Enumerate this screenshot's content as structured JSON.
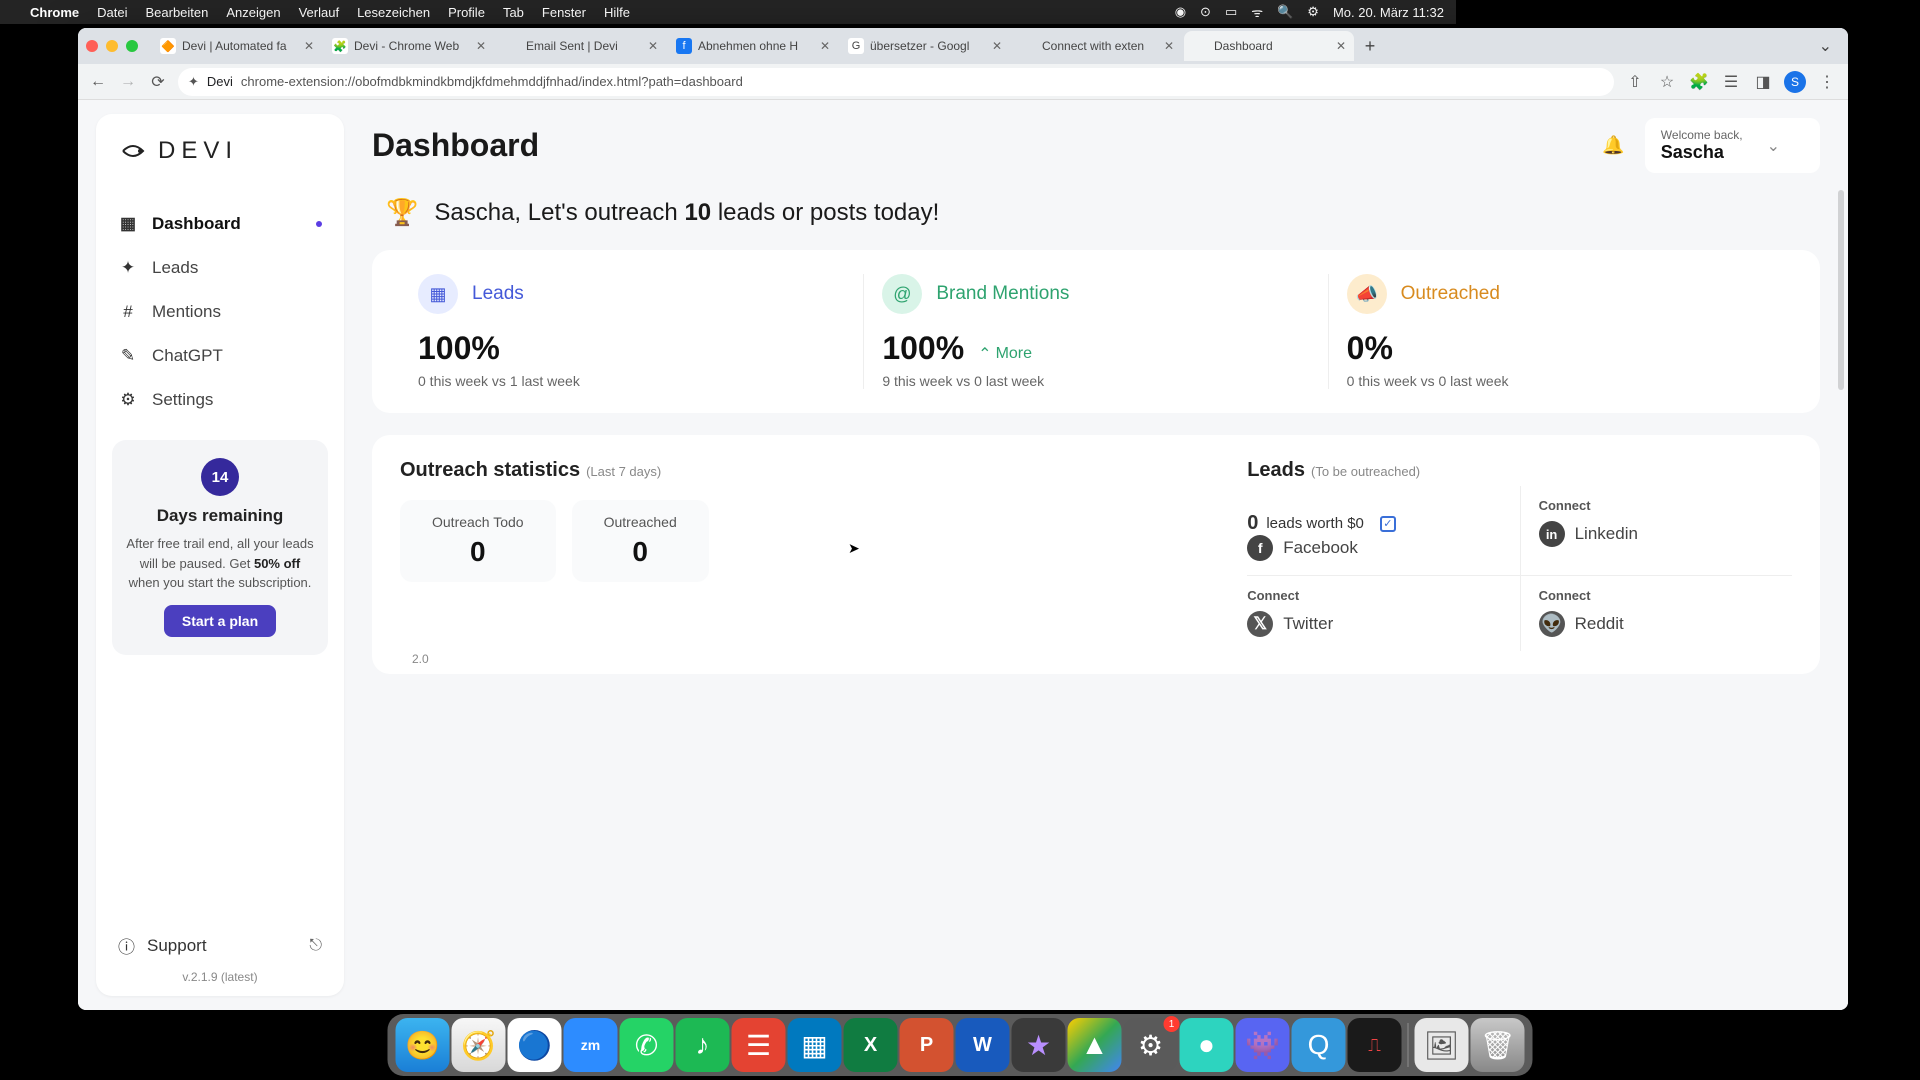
{
  "menubar": {
    "app": "Chrome",
    "items": [
      "Datei",
      "Bearbeiten",
      "Anzeigen",
      "Verlauf",
      "Lesezeichen",
      "Profile",
      "Tab",
      "Fenster",
      "Hilfe"
    ],
    "clock": "Mo. 20. März  11:32"
  },
  "tabs": [
    {
      "label": "Devi | Automated fa"
    },
    {
      "label": "Devi - Chrome Web"
    },
    {
      "label": "Email Sent | Devi"
    },
    {
      "label": "Abnehmen ohne H"
    },
    {
      "label": "übersetzer - Googl"
    },
    {
      "label": "Connect with exten"
    },
    {
      "label": "Dashboard",
      "active": true
    }
  ],
  "addressbar": {
    "host": "Devi",
    "path": "chrome-extension://obofmdbkmindkbmdjkfdmehmddjfnhad/index.html?path=dashboard"
  },
  "sidebar": {
    "logo": "DEVI",
    "nav": [
      {
        "label": "Dashboard",
        "active": true
      },
      {
        "label": "Leads"
      },
      {
        "label": "Mentions"
      },
      {
        "label": "ChatGPT"
      },
      {
        "label": "Settings"
      }
    ],
    "trial": {
      "days": "14",
      "title": "Days remaining",
      "text_pre": "After free trail end, all your leads will be paused. Get ",
      "discount": "50% off",
      "text_post": " when you start the subscription.",
      "button": "Start a plan"
    },
    "support": "Support",
    "version": "v.2.1.9 (latest)"
  },
  "header": {
    "title": "Dashboard",
    "welcome_label": "Welcome back,",
    "name": "Sascha"
  },
  "headline": {
    "pre": "Sascha, Let's outreach ",
    "count": "10",
    "post": " leads or posts today!"
  },
  "stats": [
    {
      "label": "Leads",
      "value": "100%",
      "sub": "0 this week vs 1 last week",
      "color": "blue"
    },
    {
      "label": "Brand Mentions",
      "value": "100%",
      "more": "More",
      "sub": "9 this week vs 0 last week",
      "color": "green"
    },
    {
      "label": "Outreached",
      "value": "0%",
      "sub": "0 this week vs 0 last week",
      "color": "yellow"
    }
  ],
  "outreach": {
    "title": "Outreach statistics",
    "sub": "(Last 7 days)",
    "todo_label": "Outreach Todo",
    "todo_value": "0",
    "done_label": "Outreached",
    "done_value": "0",
    "axis": "2.0"
  },
  "leads": {
    "title": "Leads",
    "sub": "(To be outreached)",
    "worth_zero": "0",
    "worth_text": "leads worth $0",
    "connect": "Connect",
    "platforms": [
      "Facebook",
      "Linkedin",
      "Twitter",
      "Reddit"
    ]
  }
}
